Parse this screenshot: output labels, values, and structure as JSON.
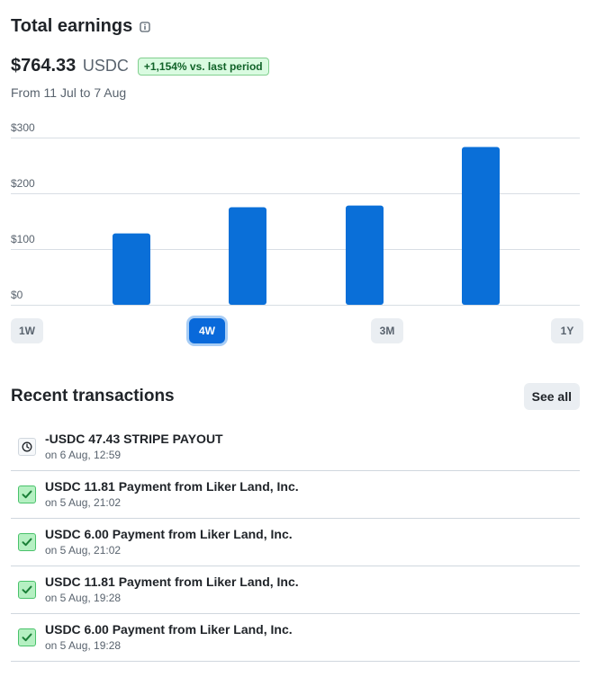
{
  "earnings": {
    "title": "Total earnings",
    "info_icon": "info-icon",
    "amount": "$764.33",
    "currency": "USDC",
    "change": "+1,154% vs. last period",
    "period": "From 11 Jul to 7 Aug"
  },
  "colors": {
    "bar": "#0a6fd8",
    "accent": "#0969da",
    "positive_bg": "#dafbe1",
    "positive_text": "#116329"
  },
  "chart_data": {
    "type": "bar",
    "categories": [
      "",
      "",
      "",
      ""
    ],
    "values": [
      128,
      175,
      178,
      283
    ],
    "y_ticks": [
      "$0",
      "$100",
      "$200",
      "$300"
    ],
    "ylim": [
      0,
      300
    ],
    "grid": true,
    "title": "",
    "xlabel": "",
    "ylabel": ""
  },
  "ranges": {
    "options": [
      "1W",
      "4W",
      "3M",
      "1Y"
    ],
    "selected": "4W"
  },
  "transactions": {
    "title": "Recent transactions",
    "see_all": "See all",
    "items": [
      {
        "label": "-USDC 47.43 STRIPE PAYOUT",
        "time": "on 6 Aug, 12:59",
        "status": "pending",
        "icon": "clock-icon"
      },
      {
        "label": "USDC 11.81 Payment from Liker Land, Inc.",
        "time": "on 5 Aug, 21:02",
        "status": "done",
        "icon": "check-icon"
      },
      {
        "label": "USDC 6.00 Payment from Liker Land, Inc.",
        "time": "on 5 Aug, 21:02",
        "status": "done",
        "icon": "check-icon"
      },
      {
        "label": "USDC 11.81 Payment from Liker Land, Inc.",
        "time": "on 5 Aug, 19:28",
        "status": "done",
        "icon": "check-icon"
      },
      {
        "label": "USDC 6.00 Payment from Liker Land, Inc.",
        "time": "on 5 Aug, 19:28",
        "status": "done",
        "icon": "check-icon"
      }
    ]
  }
}
